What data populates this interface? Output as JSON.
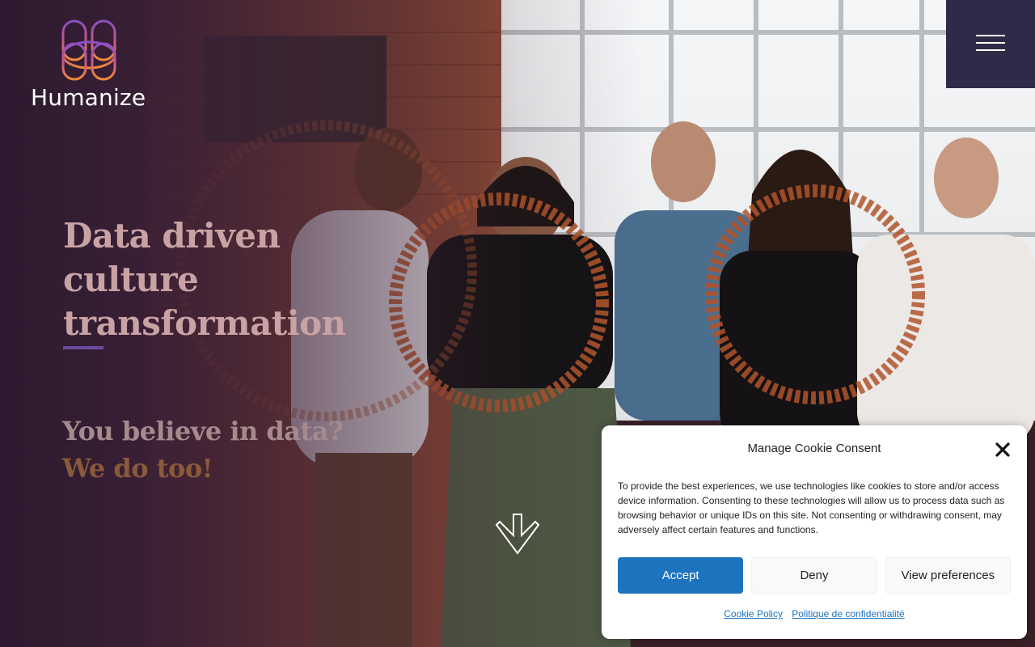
{
  "brand": {
    "name": "Humanize",
    "logo_icon": "humanize-knot-logo"
  },
  "menu": {
    "icon": "hamburger-menu-icon"
  },
  "hero": {
    "headline_lines": [
      "Data driven",
      "culture",
      "transformation"
    ],
    "tagline_line_1": "You believe in data?",
    "tagline_line_2": "We do too!",
    "scroll_icon": "arrow-down-icon"
  },
  "cookie_banner": {
    "title": "Manage Cookie Consent",
    "body": "To provide the best experiences, we use technologies like cookies to store and/or access device information. Consenting to these technologies will allow us to process data such as browsing behavior or unique IDs on this site. Not consenting or withdrawing consent, may adversely affect certain features and functions.",
    "accept_label": "Accept",
    "deny_label": "Deny",
    "preferences_label": "View preferences",
    "cookie_policy_link": "Cookie Policy",
    "privacy_policy_link": "Politique de confidentialité",
    "close_icon": "close-icon"
  },
  "colors": {
    "menu_bg": "#2f2a48",
    "accept_button": "#1e73be",
    "headline": "#c9a2a4",
    "accent_underline": "#6b4ba0",
    "ring_orange": "#b0542a"
  }
}
